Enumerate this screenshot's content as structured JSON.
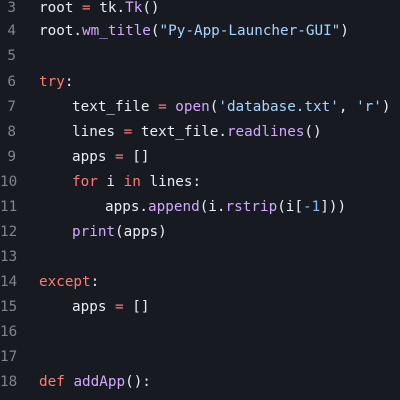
{
  "colors": {
    "background": "#171b21",
    "text": "#e6edf3",
    "line_number": "#7d8590",
    "keyword": "#ff7b72",
    "function": "#d2a8ff",
    "string": "#a5d6ff",
    "number": "#79c0ff"
  },
  "lines": [
    {
      "number": "3",
      "tokens": [
        {
          "t": "root ",
          "k": "plain"
        },
        {
          "t": "=",
          "k": "op"
        },
        {
          "t": " tk.",
          "k": "plain"
        },
        {
          "t": "Tk",
          "k": "func"
        },
        {
          "t": "()",
          "k": "plain"
        }
      ]
    },
    {
      "number": "4",
      "tokens": [
        {
          "t": "root.",
          "k": "plain"
        },
        {
          "t": "wm_title",
          "k": "func"
        },
        {
          "t": "(",
          "k": "plain"
        },
        {
          "t": "\"Py-App-Launcher-GUI\"",
          "k": "str"
        },
        {
          "t": ")",
          "k": "plain"
        }
      ]
    },
    {
      "number": "5",
      "tokens": []
    },
    {
      "number": "6",
      "tokens": [
        {
          "t": "try",
          "k": "keyword"
        },
        {
          "t": ":",
          "k": "plain"
        }
      ]
    },
    {
      "number": "7",
      "tokens": [
        {
          "t": "text_file ",
          "k": "plain"
        },
        {
          "t": "=",
          "k": "op"
        },
        {
          "t": " ",
          "k": "plain"
        },
        {
          "t": "open",
          "k": "builtin"
        },
        {
          "t": "(",
          "k": "plain"
        },
        {
          "t": "'database.txt'",
          "k": "str"
        },
        {
          "t": ", ",
          "k": "plain"
        },
        {
          "t": "'r'",
          "k": "str"
        },
        {
          "t": ")",
          "k": "plain"
        }
      ]
    },
    {
      "number": "8",
      "tokens": [
        {
          "t": "lines ",
          "k": "plain"
        },
        {
          "t": "=",
          "k": "op"
        },
        {
          "t": " text_file.",
          "k": "plain"
        },
        {
          "t": "readlines",
          "k": "func"
        },
        {
          "t": "()",
          "k": "plain"
        }
      ]
    },
    {
      "number": "9",
      "tokens": [
        {
          "t": "apps ",
          "k": "plain"
        },
        {
          "t": "=",
          "k": "op"
        },
        {
          "t": " []",
          "k": "plain"
        }
      ]
    },
    {
      "number": "10",
      "tokens": [
        {
          "t": "for",
          "k": "keyword"
        },
        {
          "t": " i ",
          "k": "plain"
        },
        {
          "t": "in",
          "k": "keyword"
        },
        {
          "t": " lines:",
          "k": "plain"
        }
      ]
    },
    {
      "number": "11",
      "tokens": [
        {
          "t": "apps.",
          "k": "plain"
        },
        {
          "t": "append",
          "k": "func"
        },
        {
          "t": "(i.",
          "k": "plain"
        },
        {
          "t": "rstrip",
          "k": "func"
        },
        {
          "t": "(i[",
          "k": "plain"
        },
        {
          "t": "-1",
          "k": "num"
        },
        {
          "t": "]))",
          "k": "plain"
        }
      ]
    },
    {
      "number": "12",
      "tokens": [
        {
          "t": "print",
          "k": "builtin"
        },
        {
          "t": "(apps)",
          "k": "plain"
        }
      ]
    },
    {
      "number": "13",
      "tokens": []
    },
    {
      "number": "14",
      "tokens": [
        {
          "t": "except",
          "k": "keyword"
        },
        {
          "t": ":",
          "k": "plain"
        }
      ]
    },
    {
      "number": "15",
      "tokens": [
        {
          "t": "apps ",
          "k": "plain"
        },
        {
          "t": "=",
          "k": "op"
        },
        {
          "t": " []",
          "k": "plain"
        }
      ]
    },
    {
      "number": "16",
      "tokens": []
    },
    {
      "number": "17",
      "tokens": []
    },
    {
      "number": "18",
      "tokens": [
        {
          "t": "def",
          "k": "keyword"
        },
        {
          "t": " ",
          "k": "plain"
        },
        {
          "t": "addApp",
          "k": "func"
        },
        {
          "t": "():",
          "k": "plain"
        }
      ]
    }
  ]
}
